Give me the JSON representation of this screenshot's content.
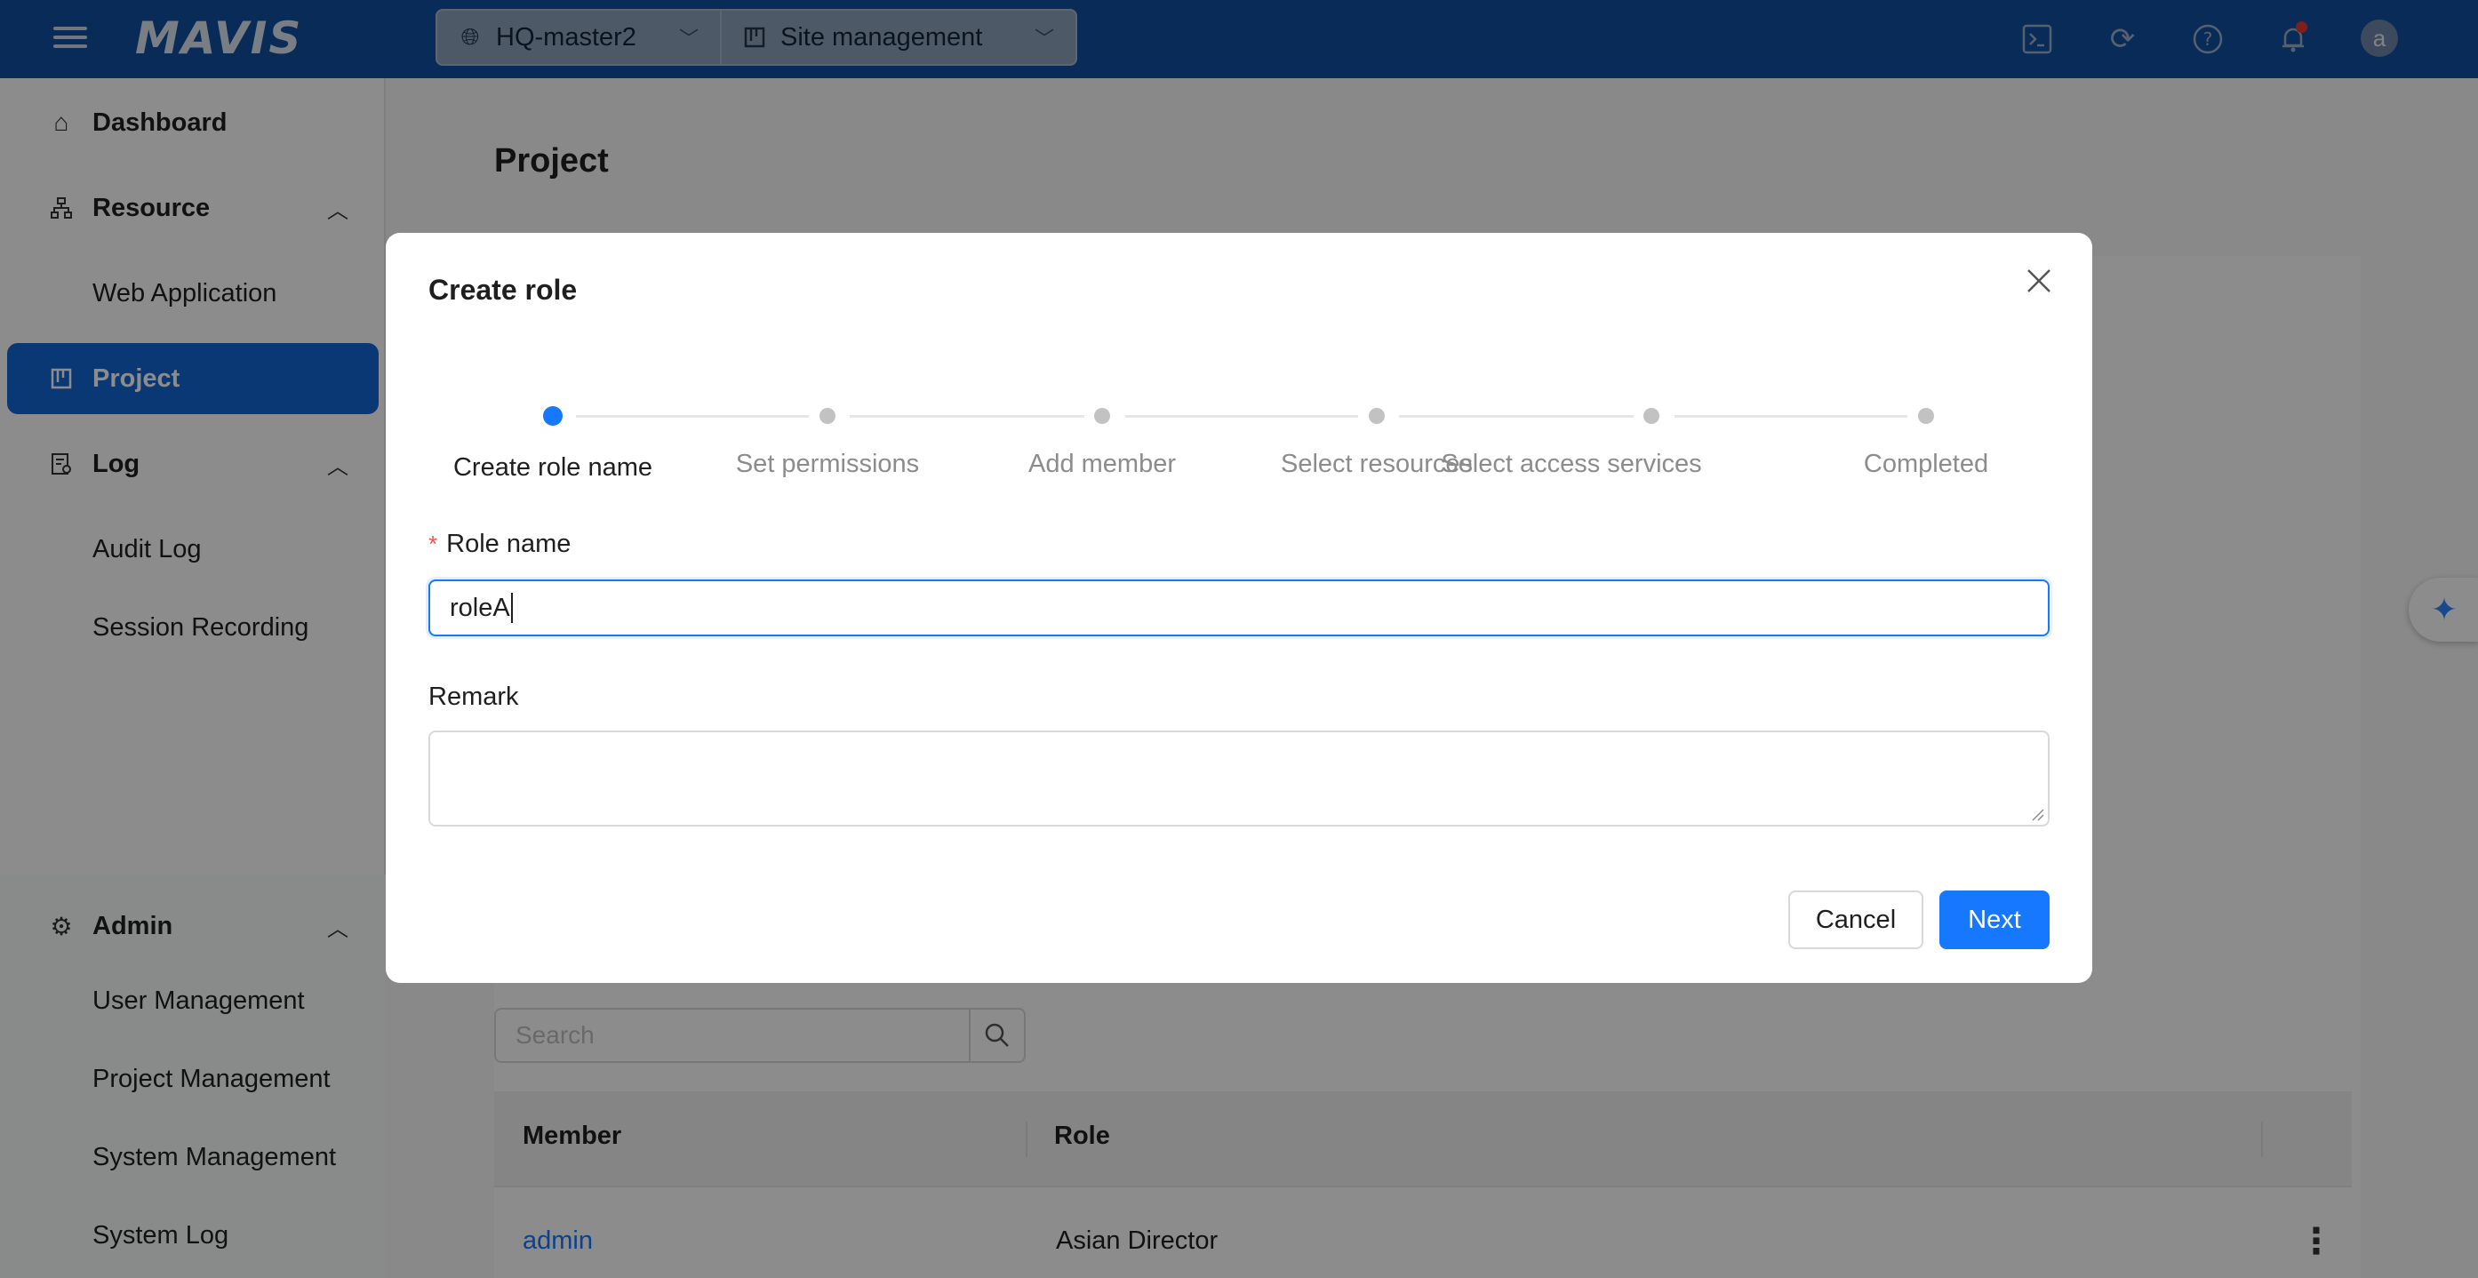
{
  "header": {
    "logo": "MAVIS",
    "site_selector": "HQ-master2",
    "module_selector": "Site management",
    "icons": [
      "terminal-icon",
      "refresh-icon",
      "help-icon",
      "bell-icon"
    ],
    "avatar_letter": "a"
  },
  "sidebar": {
    "dashboard": "Dashboard",
    "resource": "Resource",
    "web_application": "Web Application",
    "project": "Project",
    "log": "Log",
    "audit_log": "Audit Log",
    "session_recording": "Session Recording",
    "admin": "Admin",
    "user_management": "User Management",
    "project_management": "Project Management",
    "system_management": "System Management",
    "system_log": "System Log"
  },
  "main": {
    "page_title": "Project",
    "search_placeholder": "Search",
    "table": {
      "columns": [
        "Member",
        "Role"
      ],
      "rows": [
        {
          "member": "admin",
          "role": "Asian Director"
        }
      ]
    }
  },
  "modal": {
    "title": "Create role",
    "steps": [
      "Create role name",
      "Set permissions",
      "Add member",
      "Select resources",
      "Select access services",
      "Completed"
    ],
    "active_step": 0,
    "role_name_label": "Role name",
    "role_name_value": "roleA",
    "remark_label": "Remark",
    "remark_value": "",
    "cancel": "Cancel",
    "next": "Next"
  },
  "colors": {
    "header_bg": "#0f4fa0",
    "primary": "#1677ff",
    "sidebar_active": "#1366d6",
    "required": "#ff4d4f"
  }
}
